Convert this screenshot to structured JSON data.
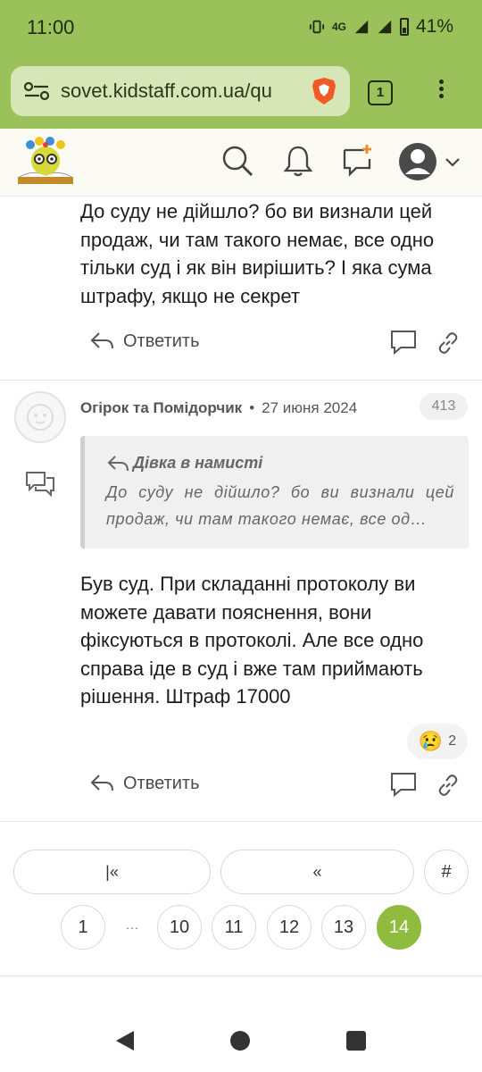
{
  "status": {
    "time": "11:00",
    "network": "4G",
    "battery": "41%"
  },
  "browser": {
    "url": "sovet.kidstaff.com.ua/qu",
    "tab_count": "1"
  },
  "post1": {
    "text": "До суду не дійшло? бо ви визнали цей продаж, чи там такого немає, все одно тільки суд і як він вирішить? І яка сума штрафу, якщо не секрет",
    "reply_label": "Ответить"
  },
  "post2": {
    "author": "Огірок та Помідорчик",
    "separator": "•",
    "date": "27 июня 2024",
    "number": "413",
    "quote_author": "Дівка в намисті",
    "quote_text": "До суду не дійшло? бо ви визнали цей продаж, чи там такого немає, все од…",
    "text": "Був суд. При складанні протоколу ви можете давати пояснення, вони фіксуються в протоколі. Але все одно справа іде в суд і вже там приймають рішення. Штраф 17000",
    "reaction_emoji": "😢",
    "reaction_count": "2",
    "reply_label": "Ответить"
  },
  "pagination": {
    "first": "|«",
    "prev": "«",
    "goto": "#",
    "pages": [
      "1",
      "10",
      "11",
      "12",
      "13",
      "14"
    ],
    "ellipsis": "…",
    "current": "14"
  },
  "icons": {
    "search": "search-icon",
    "bell": "bell-icon",
    "new_post": "new-post-icon",
    "user": "user-avatar-icon",
    "chevron": "chevron-down-icon"
  },
  "colors": {
    "accent": "#9bc25a",
    "active_page": "#8fbc3e"
  }
}
